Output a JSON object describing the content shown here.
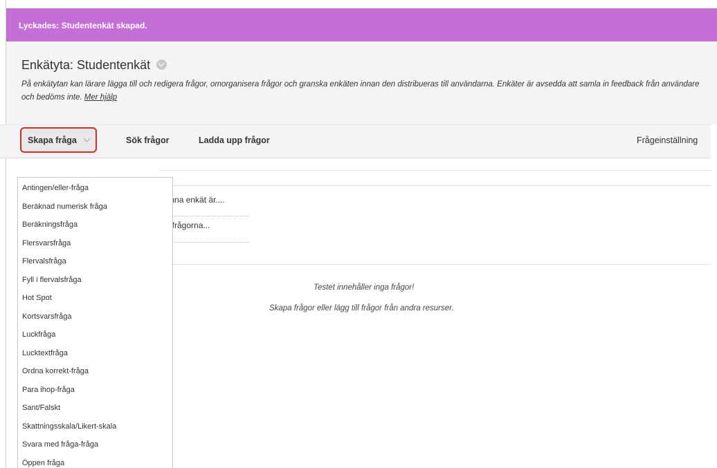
{
  "banner": {
    "text": "Lyckades: Studentenkät skapad."
  },
  "header": {
    "title": "Enkätyta: Studentenkät",
    "description": "På enkätytan kan lärare lägga till och redigera frågor, omorganisera frågor och granska enkäten innan den distribueras till användarna. Enkäter är avsedda att samla in feedback från användare och bedöms inte.",
    "help_link": "Mer hjälp"
  },
  "toolbar": {
    "create_label": "Skapa fråga",
    "search_label": "Sök frågor",
    "upload_label": "Ladda upp frågor",
    "settings_label": "Frågeinställning"
  },
  "content": {
    "rows": [
      "denna enkät är....",
      "på frågorna..."
    ],
    "empty_title": "Testet innehåller inga frågor!",
    "empty_hint": "Skapa frågor eller lägg till frågor från andra resurser."
  },
  "dropdown": {
    "items": [
      "Antingen/eller-fråga",
      "Beräknad numerisk fråga",
      "Beräkningsfråga",
      "Flersvarsfråga",
      "Flervalsfråga",
      "Fyll i flervalsfråga",
      "Hot Spot",
      "Kortsvarsfråga",
      "Luckfråga",
      "Lucktextfråga",
      "Ordna korrekt-fråga",
      "Para ihop-fråga",
      "Sant/Falskt",
      "Skattningsskala/Likert-skala",
      "Svara med fråga-fråga",
      "Öppen fråga"
    ]
  },
  "colors": {
    "banner": "#c36fd5",
    "highlight": "#d42c2c"
  }
}
